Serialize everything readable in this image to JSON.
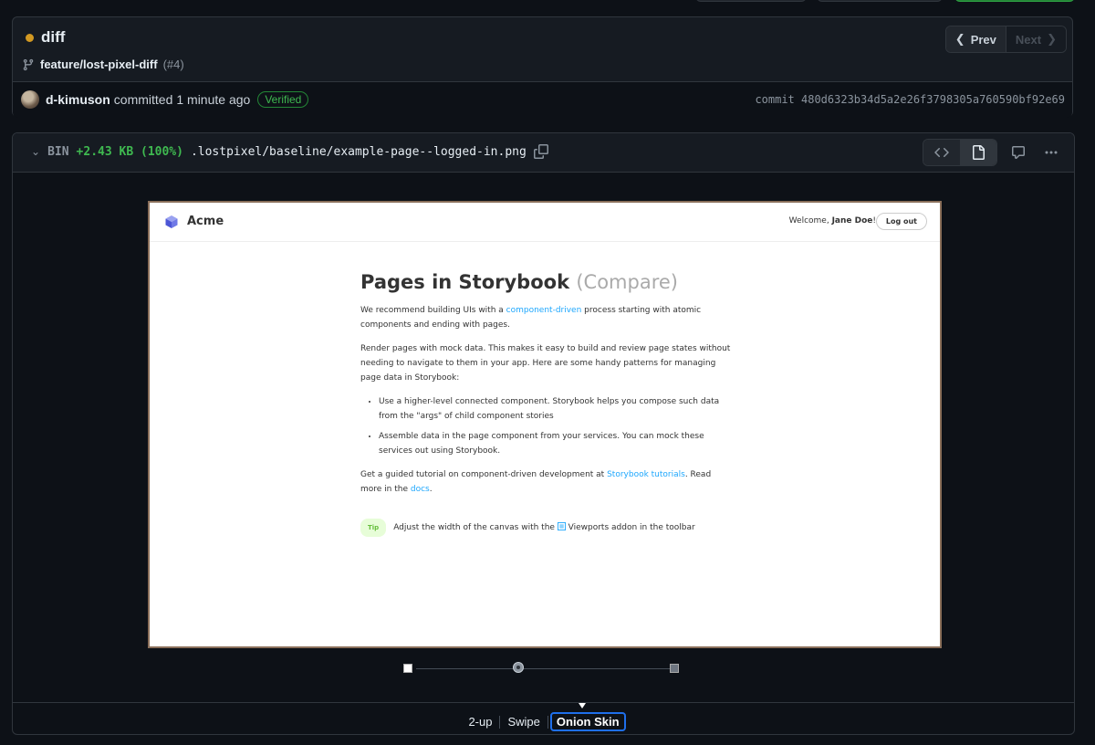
{
  "commit": {
    "status_color": "#d29922",
    "title": "diff",
    "branch": "feature/lost-pixel-diff",
    "pr_number": "(#4)",
    "nav": {
      "prev_label": "Prev",
      "next_label": "Next"
    },
    "author": "d-kimuson",
    "action": "committed",
    "time": "1 minute ago",
    "verified_label": "Verified",
    "sha_label": "commit 480d6323b34d5a2e26f3798305a760590bf92e69"
  },
  "file": {
    "type": "BIN",
    "added": "+2.43 KB (100%)",
    "path": ".lostpixel/baseline/example-page--logged-in.png"
  },
  "preview": {
    "brand": "Acme",
    "welcome_prefix": "Welcome,",
    "user_name": "Jane Doe",
    "welcome_suffix": "!",
    "logout_label": "Log out",
    "heading": "Pages in Storybook",
    "heading_compare": "(Compare)",
    "p1_before": "We recommend building UIs with a ",
    "p1_link": "component-driven",
    "p1_after": " process starting with atomic components and ending with pages.",
    "p2": "Render pages with mock data. This makes it easy to build and review page states without needing to navigate to them in your app. Here are some handy patterns for managing page data in Storybook:",
    "bullets": [
      "Use a higher-level connected component. Storybook helps you compose such data from the \"args\" of child component stories",
      "Assemble data in the page component from your services. You can mock these services out using Storybook."
    ],
    "p3_before": "Get a guided tutorial on component-driven development at ",
    "p3_link1": "Storybook tutorials",
    "p3_mid": ". Read more in the ",
    "p3_link2": "docs",
    "p3_after": ".",
    "tip_label": "Tip",
    "tip_before": "Adjust the width of the canvas with the ",
    "tip_after": " Viewports addon in the toolbar"
  },
  "onion_opacity": 0.4,
  "modes": [
    "2-up",
    "Swipe",
    "Onion Skin"
  ],
  "active_mode": "Onion Skin"
}
